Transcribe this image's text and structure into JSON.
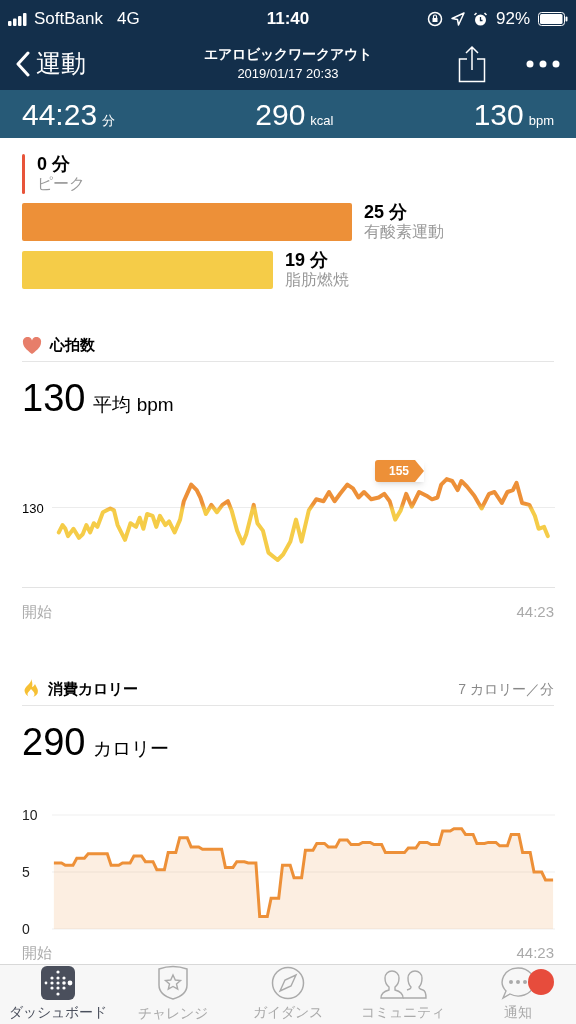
{
  "status_bar": {
    "carrier": "SoftBank",
    "network": "4G",
    "time": "11:40",
    "battery": "92%"
  },
  "nav": {
    "back": "運動",
    "title": "エアロビックワークアウト",
    "subtitle": "2019/01/17 20:33"
  },
  "summary": [
    {
      "value": "44:23",
      "unit": "分"
    },
    {
      "value": "290",
      "unit": "kcal"
    },
    {
      "value": "130",
      "unit": "bpm"
    }
  ],
  "zones": [
    {
      "minutes": "0 分",
      "label": "ピーク",
      "color": "#e8543a"
    },
    {
      "minutes": "25 分",
      "label": "有酸素運動",
      "color": "#ed9038"
    },
    {
      "minutes": "19 分",
      "label": "脂肪燃焼",
      "color": "#f5cc48"
    }
  ],
  "heart_rate": {
    "title": "心拍数",
    "value": "130",
    "unit": "平均 bpm",
    "y_tick": "130",
    "peak_label": "155",
    "start_label": "開始",
    "end_label": "44:23"
  },
  "calories": {
    "title": "消費カロリー",
    "rate": "7 カロリー／分",
    "value": "290",
    "unit": "カロリー",
    "start_label": "開始",
    "end_label": "44:23",
    "chart_data": {
      "type": "area",
      "categories": [
        null,
        null,
        null,
        null,
        null,
        null,
        null,
        null,
        null,
        null,
        null,
        null,
        null,
        null,
        null,
        null,
        null,
        null,
        null,
        null,
        null,
        null,
        null,
        null,
        null,
        null,
        null,
        null,
        null,
        null,
        null,
        null,
        null,
        null,
        null,
        null,
        null,
        null,
        null,
        null,
        null,
        null,
        null,
        null,
        null,
        null,
        null,
        null,
        null,
        null,
        null,
        null,
        null,
        null,
        null,
        null,
        null,
        null,
        null,
        null,
        null,
        null,
        null,
        null,
        null,
        null,
        null,
        null,
        null,
        null,
        null,
        null,
        null,
        null,
        null,
        null,
        null,
        null,
        null,
        null,
        null,
        null,
        null,
        null,
        null,
        null,
        null,
        null,
        null,
        null,
        null,
        null,
        null,
        null,
        null,
        null,
        null,
        null,
        null,
        null,
        null,
        null,
        null,
        null,
        null,
        null,
        null,
        null,
        null,
        null,
        null,
        null,
        null,
        null,
        null,
        null,
        null,
        null,
        null,
        null,
        null,
        null,
        null,
        null,
        null,
        null,
        null,
        null,
        null,
        null,
        null,
        null
      ],
      "series": [
        {
          "color": "#ed9038",
          "values": [
            5.8,
            5.8,
            5.8,
            5.6,
            5.6,
            5.6,
            6.2,
            6.2,
            6.2,
            6.6,
            6.6,
            6.6,
            6.6,
            6.6,
            6.6,
            5.6,
            5.6,
            5.6,
            5.8,
            5.8,
            5.8,
            6.4,
            6.4,
            6.4,
            5.9,
            5.9,
            5.9,
            5.2,
            5.2,
            5.2,
            6.7,
            6.7,
            6.7,
            8.0,
            8.0,
            8.0,
            7.2,
            7.2,
            7.2,
            7.0,
            7.0,
            7.0,
            7.0,
            7.0,
            7.0,
            5.4,
            5.4,
            5.4,
            5.9,
            5.9,
            5.9,
            5.8,
            5.8,
            5.8,
            1.1,
            1.1,
            1.1,
            2.7,
            2.7,
            2.7,
            5.6,
            5.6,
            5.6,
            4.5,
            4.5,
            4.5,
            6.9,
            6.9,
            6.9,
            7.5,
            7.5,
            7.5,
            7.2,
            7.2,
            7.2,
            7.8,
            7.8,
            7.8,
            7.4,
            7.4,
            7.4,
            7.6,
            7.6,
            7.6,
            7.4,
            7.4,
            7.4,
            6.7,
            6.7,
            6.7,
            6.7,
            6.7,
            6.7,
            7.1,
            7.1,
            7.1,
            7.6,
            7.6,
            7.6,
            7.4,
            7.4,
            7.4,
            8.6,
            8.6,
            8.6,
            8.8,
            8.8,
            8.8,
            8.3,
            8.3,
            8.3,
            7.5,
            7.5,
            7.5,
            7.6,
            7.6,
            7.6,
            7.3,
            7.3,
            7.3,
            8.3,
            8.3,
            8.3,
            6.7,
            6.7,
            6.7,
            5.0,
            5.0,
            5.0,
            4.3,
            4.3,
            4.3
          ]
        }
      ],
      "ylim": [
        0,
        10
      ],
      "yticks": [
        0,
        5,
        10
      ]
    }
  },
  "tabs": [
    {
      "label": "ダッシュボード",
      "selected": true,
      "badge": false
    },
    {
      "label": "チャレンジ",
      "selected": false,
      "badge": false
    },
    {
      "label": "ガイダンス",
      "selected": false,
      "badge": false
    },
    {
      "label": "コミュニティ",
      "selected": false,
      "badge": false
    },
    {
      "label": "通知",
      "selected": false,
      "badge": true
    }
  ]
}
